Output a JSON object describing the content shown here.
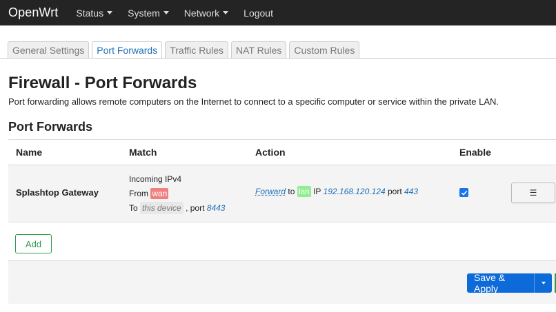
{
  "brand": "OpenWrt",
  "nav": {
    "status": "Status",
    "system": "System",
    "network": "Network",
    "logout": "Logout"
  },
  "tabs": [
    "General Settings",
    "Port Forwards",
    "Traffic Rules",
    "NAT Rules",
    "Custom Rules"
  ],
  "active_tab": "Port Forwards",
  "page": {
    "title": "Firewall - Port Forwards",
    "description": "Port forwarding allows remote computers on the Internet to connect to a specific computer or service within the private LAN.",
    "section_title": "Port Forwards"
  },
  "table": {
    "headers": {
      "name": "Name",
      "match": "Match",
      "action": "Action",
      "enable": "Enable"
    },
    "rows": [
      {
        "name": "Splashtop Gateway",
        "match": {
          "line1": "Incoming IPv4",
          "from_label": "From",
          "from_zone": "wan",
          "to_label": "To",
          "to_device": "this device",
          "port_label": ", port",
          "port": "8443"
        },
        "action": {
          "verb": "Forward",
          "to": "to",
          "zone": "lan",
          "ip_label": "IP",
          "ip": "192.168.120.124",
          "port_label": "port",
          "port": "443"
        },
        "enabled": true,
        "menu_glyph": "☰"
      }
    ]
  },
  "buttons": {
    "add": "Add",
    "save_apply": "Save & Apply"
  },
  "colors": {
    "navbar": "#242424",
    "wan_zone": "#f08080",
    "lan_zone": "#90ee90",
    "primary": "#0d6bd9",
    "add_green": "#2c9b4b"
  }
}
